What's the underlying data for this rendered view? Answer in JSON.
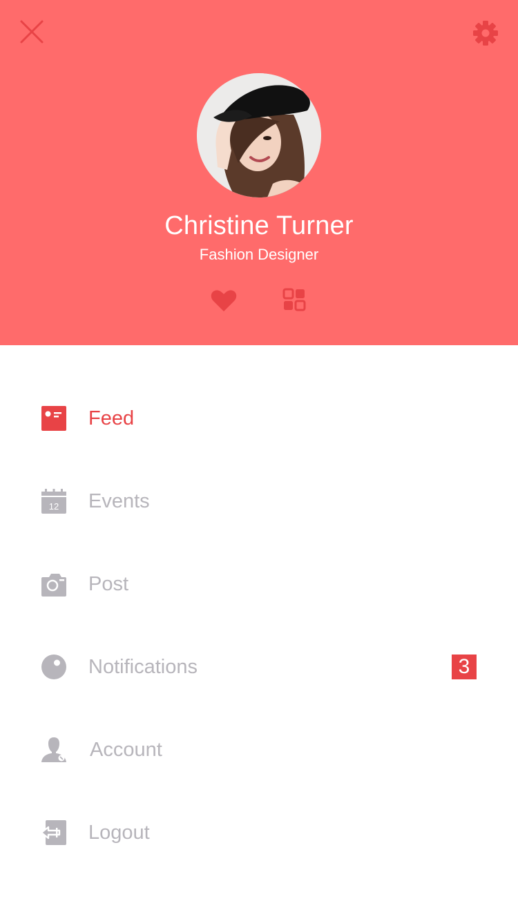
{
  "colors": {
    "header_bg": "#ff6b6b",
    "accent": "#e84346",
    "muted": "#b7b5bb",
    "background": "#ffffff"
  },
  "header": {
    "close_icon": "close-icon",
    "settings_icon": "gear-icon",
    "profile": {
      "name": "Christine Turner",
      "role": "Fashion Designer"
    },
    "actions": [
      {
        "icon": "heart-icon"
      },
      {
        "icon": "grid-icon"
      }
    ]
  },
  "menu": {
    "items": [
      {
        "label": "Feed",
        "icon": "feed-icon",
        "active": true
      },
      {
        "label": "Events",
        "icon": "calendar-icon",
        "calendar_day": "12"
      },
      {
        "label": "Post",
        "icon": "camera-icon"
      },
      {
        "label": "Notifications",
        "icon": "notification-icon",
        "badge": "3"
      },
      {
        "label": "Account",
        "icon": "user-icon"
      },
      {
        "label": "Logout",
        "icon": "logout-icon"
      }
    ]
  }
}
